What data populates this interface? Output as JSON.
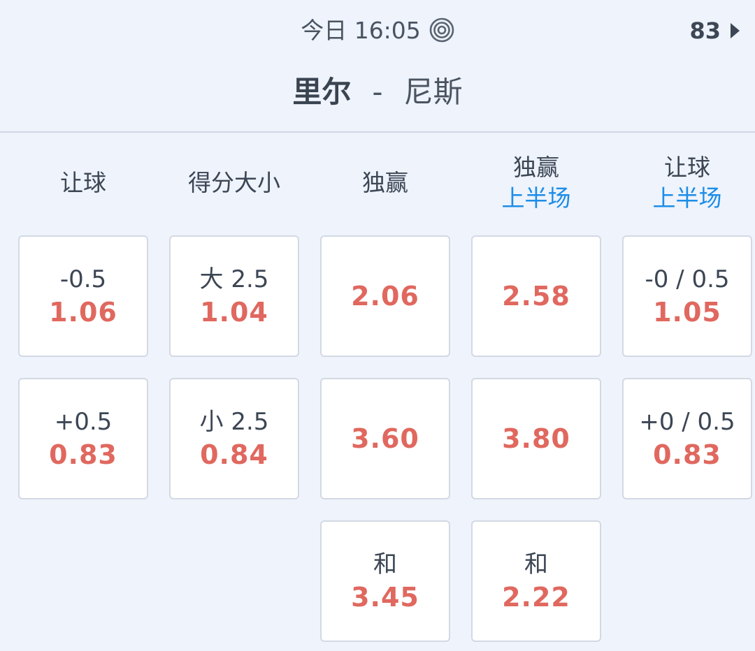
{
  "header": {
    "match_time": "今日 16:05",
    "live_icon": "target-icon",
    "market_count": "83",
    "home_team": "里尔",
    "separator": "-",
    "away_team": "尼斯"
  },
  "columns": [
    {
      "title": "让球",
      "subtitle": ""
    },
    {
      "title": "得分大小",
      "subtitle": ""
    },
    {
      "title": "独赢",
      "subtitle": ""
    },
    {
      "title": "独赢",
      "subtitle": "上半场"
    },
    {
      "title": "让球",
      "subtitle": "上半场"
    }
  ],
  "rows": [
    [
      {
        "line": "-0.5",
        "odds": "1.06"
      },
      {
        "line": "大 2.5",
        "odds": "1.04"
      },
      {
        "line": "",
        "odds": "2.06"
      },
      {
        "line": "",
        "odds": "2.58"
      },
      {
        "line": "-0 / 0.5",
        "odds": "1.05"
      }
    ],
    [
      {
        "line": "+0.5",
        "odds": "0.83"
      },
      {
        "line": "小 2.5",
        "odds": "0.84"
      },
      {
        "line": "",
        "odds": "3.60"
      },
      {
        "line": "",
        "odds": "3.80"
      },
      {
        "line": "+0 / 0.5",
        "odds": "0.83"
      }
    ],
    [
      null,
      null,
      {
        "line": "和",
        "odds": "3.45"
      },
      {
        "line": "和",
        "odds": "2.22"
      },
      null
    ]
  ],
  "colors": {
    "background": "#eef3fc",
    "odds": "#e0685f",
    "subtitle": "#1d8de6",
    "text": "#3c4654"
  }
}
